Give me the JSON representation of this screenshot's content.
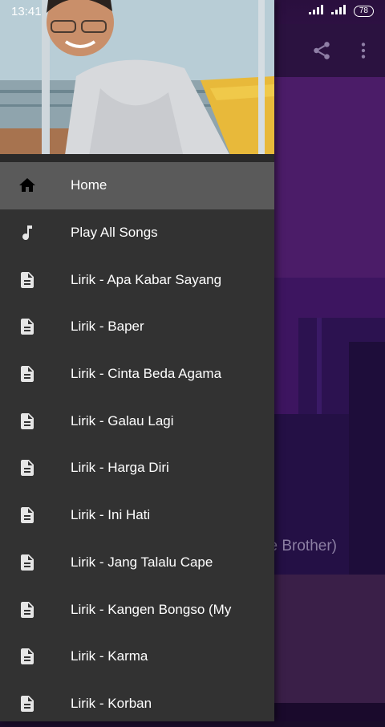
{
  "status_bar": {
    "time": "13:41",
    "battery": "78"
  },
  "background": {
    "subtitle_fragment": "tle Brother)"
  },
  "drawer": {
    "items": [
      {
        "label": "Home",
        "icon": "home-icon",
        "active": true
      },
      {
        "label": "Play All Songs",
        "icon": "music-note-icon"
      },
      {
        "label": "Lirik - Apa Kabar Sayang",
        "icon": "document-icon"
      },
      {
        "label": "Lirik - Baper",
        "icon": "document-icon"
      },
      {
        "label": "Lirik - Cinta Beda Agama",
        "icon": "document-icon"
      },
      {
        "label": "Lirik - Galau Lagi",
        "icon": "document-icon"
      },
      {
        "label": "Lirik - Harga Diri",
        "icon": "document-icon"
      },
      {
        "label": "Lirik - Ini Hati",
        "icon": "document-icon"
      },
      {
        "label": "Lirik - Jang Talalu Cape",
        "icon": "document-icon"
      },
      {
        "label": "Lirik - Kangen Bongso (My",
        "icon": "document-icon"
      },
      {
        "label": "Lirik - Karma",
        "icon": "document-icon"
      },
      {
        "label": "Lirik - Korban",
        "icon": "document-icon"
      }
    ]
  },
  "colors": {
    "drawer_bg": "#323232",
    "active_item_bg": "#5a5a5a",
    "text": "#ffffff"
  }
}
